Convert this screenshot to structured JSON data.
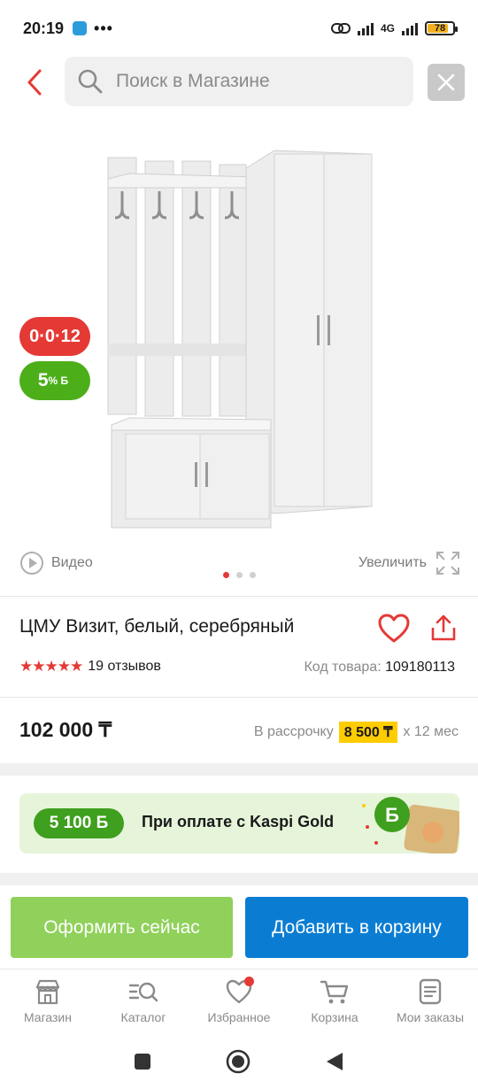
{
  "status_bar": {
    "time": "20:19",
    "more": "•••",
    "battery": "78",
    "network": "4G"
  },
  "search": {
    "placeholder": "Поиск в Магазине"
  },
  "badges": {
    "installment": "0·0·12",
    "bonus_value": "5",
    "bonus_unit": "% Б"
  },
  "gallery": {
    "video_label": "Видео",
    "zoom_label": "Увеличить",
    "slides_total": 3,
    "slide_active": 1
  },
  "product": {
    "title": "ЦМУ Визит, белый, серебряный",
    "rating_stars": "★★★★★",
    "reviews": "19 отзывов",
    "code_label": "Код товара:",
    "code_value": "109180113",
    "price": "102 000 ₸",
    "installment_prefix": "В рассрочку",
    "installment_amount": "8 500 ₸",
    "installment_suffix": "x 12 мес"
  },
  "kaspi": {
    "bonus": "5 100 Б",
    "text": "При оплате с Kaspi Gold"
  },
  "actions": {
    "order": "Оформить сейчас",
    "add_to_cart": "Добавить в корзину"
  },
  "tabs": [
    {
      "label": "Магазин",
      "icon": "store-icon"
    },
    {
      "label": "Каталог",
      "icon": "catalog-search-icon"
    },
    {
      "label": "Избранное",
      "icon": "heart-icon"
    },
    {
      "label": "Корзина",
      "icon": "cart-icon"
    },
    {
      "label": "Мои заказы",
      "icon": "orders-icon"
    }
  ],
  "colors": {
    "accent_red": "#e53935",
    "green": "#4caf1a",
    "blue": "#0a7dd3",
    "light_green": "#8fd15a",
    "highlight": "#ffcc00"
  }
}
